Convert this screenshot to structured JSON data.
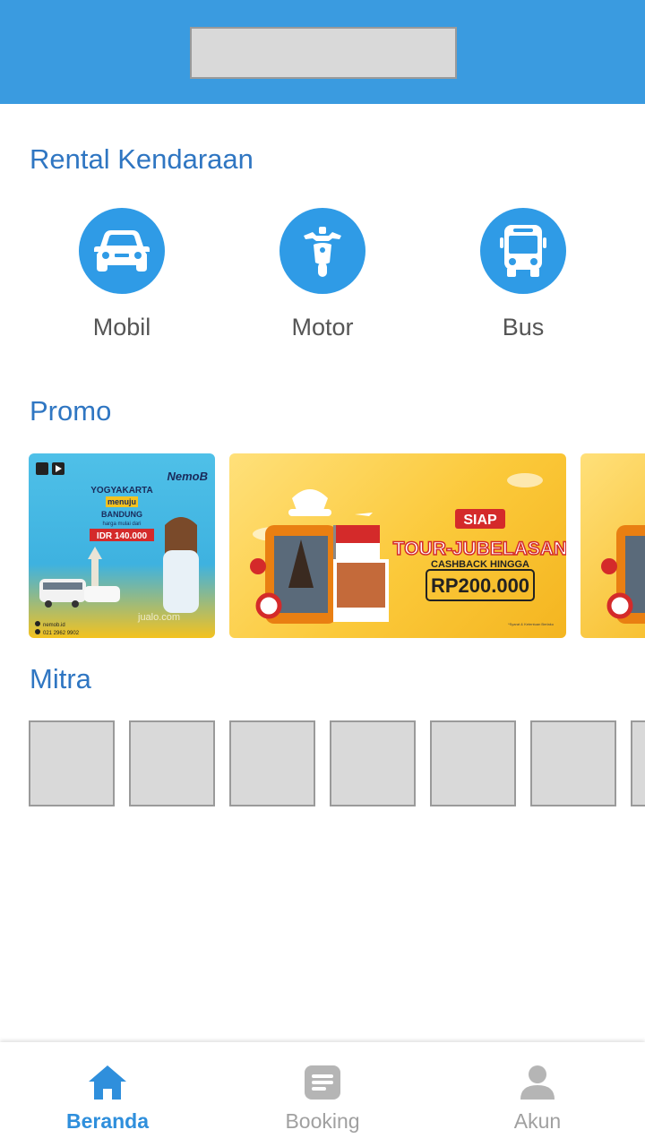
{
  "header": {
    "logo": "placeholder"
  },
  "rental": {
    "title": "Rental Kendaraan",
    "items": [
      {
        "label": "Mobil",
        "icon": "car-icon"
      },
      {
        "label": "Motor",
        "icon": "scooter-icon"
      },
      {
        "label": "Bus",
        "icon": "bus-icon"
      }
    ]
  },
  "promo": {
    "title": "Promo",
    "banners": [
      {
        "brand": "NemoB",
        "headline_1": "YOGYAKARTA",
        "headline_2": "menuju",
        "headline_3": "BANDUNG",
        "price_caption": "harga mulai dari",
        "price": "IDR 140.000",
        "site": "nemob.id",
        "phone": "021 2962 9902",
        "partner": "jualo.com"
      },
      {
        "badge": "SIAP",
        "headline": "TOUR-JUBELASAN",
        "subline": "CASHBACK HINGGA",
        "amount": "RP200.000",
        "footnote": "*Syarat & Ketentuan Berlaku"
      },
      {}
    ]
  },
  "mitra": {
    "title": "Mitra"
  },
  "nav": {
    "items": [
      {
        "label": "Beranda",
        "icon": "home-icon",
        "active": true
      },
      {
        "label": "Booking",
        "icon": "document-icon",
        "active": false
      },
      {
        "label": "Akun",
        "icon": "user-icon",
        "active": false
      }
    ]
  },
  "colors": {
    "primary": "#3a9be0",
    "title": "#2f76c2",
    "icon_bg": "#2f9be6"
  }
}
